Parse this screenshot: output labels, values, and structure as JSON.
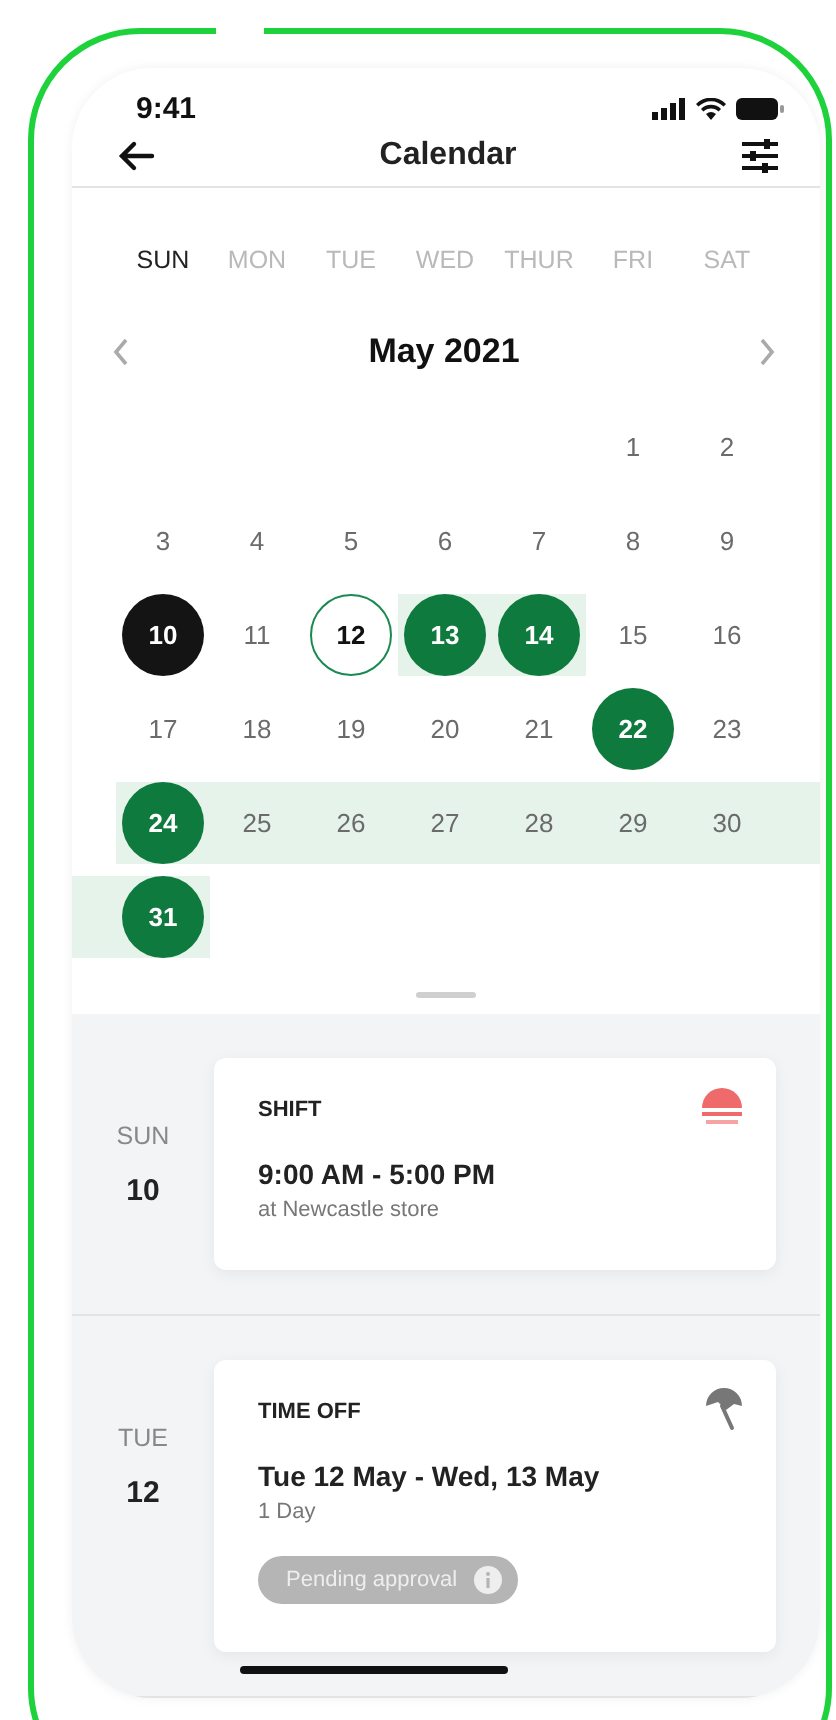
{
  "status_bar": {
    "time": "9:41"
  },
  "nav": {
    "title": "Calendar"
  },
  "weekdays": [
    {
      "label": "SUN",
      "selected": true
    },
    {
      "label": "MON",
      "selected": false
    },
    {
      "label": "TUE",
      "selected": false
    },
    {
      "label": "WED",
      "selected": false
    },
    {
      "label": "THUR",
      "selected": false
    },
    {
      "label": "FRI",
      "selected": false
    },
    {
      "label": "SAT",
      "selected": false
    }
  ],
  "month": {
    "title": "May 2021"
  },
  "weeks": [
    [
      {
        "label": "1",
        "kind": "plain",
        "in_range": false
      },
      {
        "label": "2",
        "kind": "plain",
        "in_range": false
      }
    ],
    [
      {
        "label": "3",
        "kind": "plain",
        "in_range": false
      },
      {
        "label": "4",
        "kind": "plain",
        "in_range": false
      },
      {
        "label": "5",
        "kind": "plain",
        "in_range": false
      },
      {
        "label": "6",
        "kind": "plain",
        "in_range": false
      },
      {
        "label": "7",
        "kind": "plain",
        "in_range": false
      },
      {
        "label": "8",
        "kind": "plain",
        "in_range": false
      },
      {
        "label": "9",
        "kind": "plain",
        "in_range": false
      }
    ],
    [
      {
        "label": "10",
        "kind": "today",
        "in_range": false
      },
      {
        "label": "11",
        "kind": "plain",
        "in_range": false
      },
      {
        "label": "12",
        "kind": "outlined",
        "in_range": false
      },
      {
        "label": "13",
        "kind": "filled",
        "in_range": true
      },
      {
        "label": "14",
        "kind": "filled",
        "in_range": true
      },
      {
        "label": "15",
        "kind": "plain",
        "in_range": false
      },
      {
        "label": "16",
        "kind": "plain",
        "in_range": false
      }
    ],
    [
      {
        "label": "17",
        "kind": "plain",
        "in_range": false
      },
      {
        "label": "18",
        "kind": "plain",
        "in_range": false
      },
      {
        "label": "19",
        "kind": "plain",
        "in_range": false
      },
      {
        "label": "20",
        "kind": "plain",
        "in_range": false
      },
      {
        "label": "21",
        "kind": "plain",
        "in_range": false
      },
      {
        "label": "22",
        "kind": "filled",
        "in_range": false
      },
      {
        "label": "23",
        "kind": "plain",
        "in_range": false
      }
    ],
    [
      {
        "label": "24",
        "kind": "filled",
        "in_range": true
      },
      {
        "label": "25",
        "kind": "plain",
        "in_range": true
      },
      {
        "label": "26",
        "kind": "plain",
        "in_range": true
      },
      {
        "label": "27",
        "kind": "plain",
        "in_range": true
      },
      {
        "label": "28",
        "kind": "plain",
        "in_range": true
      },
      {
        "label": "29",
        "kind": "plain",
        "in_range": true
      },
      {
        "label": "30",
        "kind": "plain",
        "in_range": true
      }
    ],
    [
      {
        "label": "31",
        "kind": "filled",
        "in_range": true
      }
    ]
  ],
  "agenda": [
    {
      "weekday": "SUN",
      "date": "10",
      "card": {
        "kind": "shift",
        "title": "SHIFT",
        "main": "9:00 AM - 5:00 PM",
        "sub": "at Newcastle store"
      }
    },
    {
      "weekday": "TUE",
      "date": "12",
      "card": {
        "kind": "time_off",
        "title": "TIME OFF",
        "main": "Tue 12 May - Wed, 13 May",
        "sub": "1 Day",
        "status": "Pending approval"
      }
    }
  ]
}
